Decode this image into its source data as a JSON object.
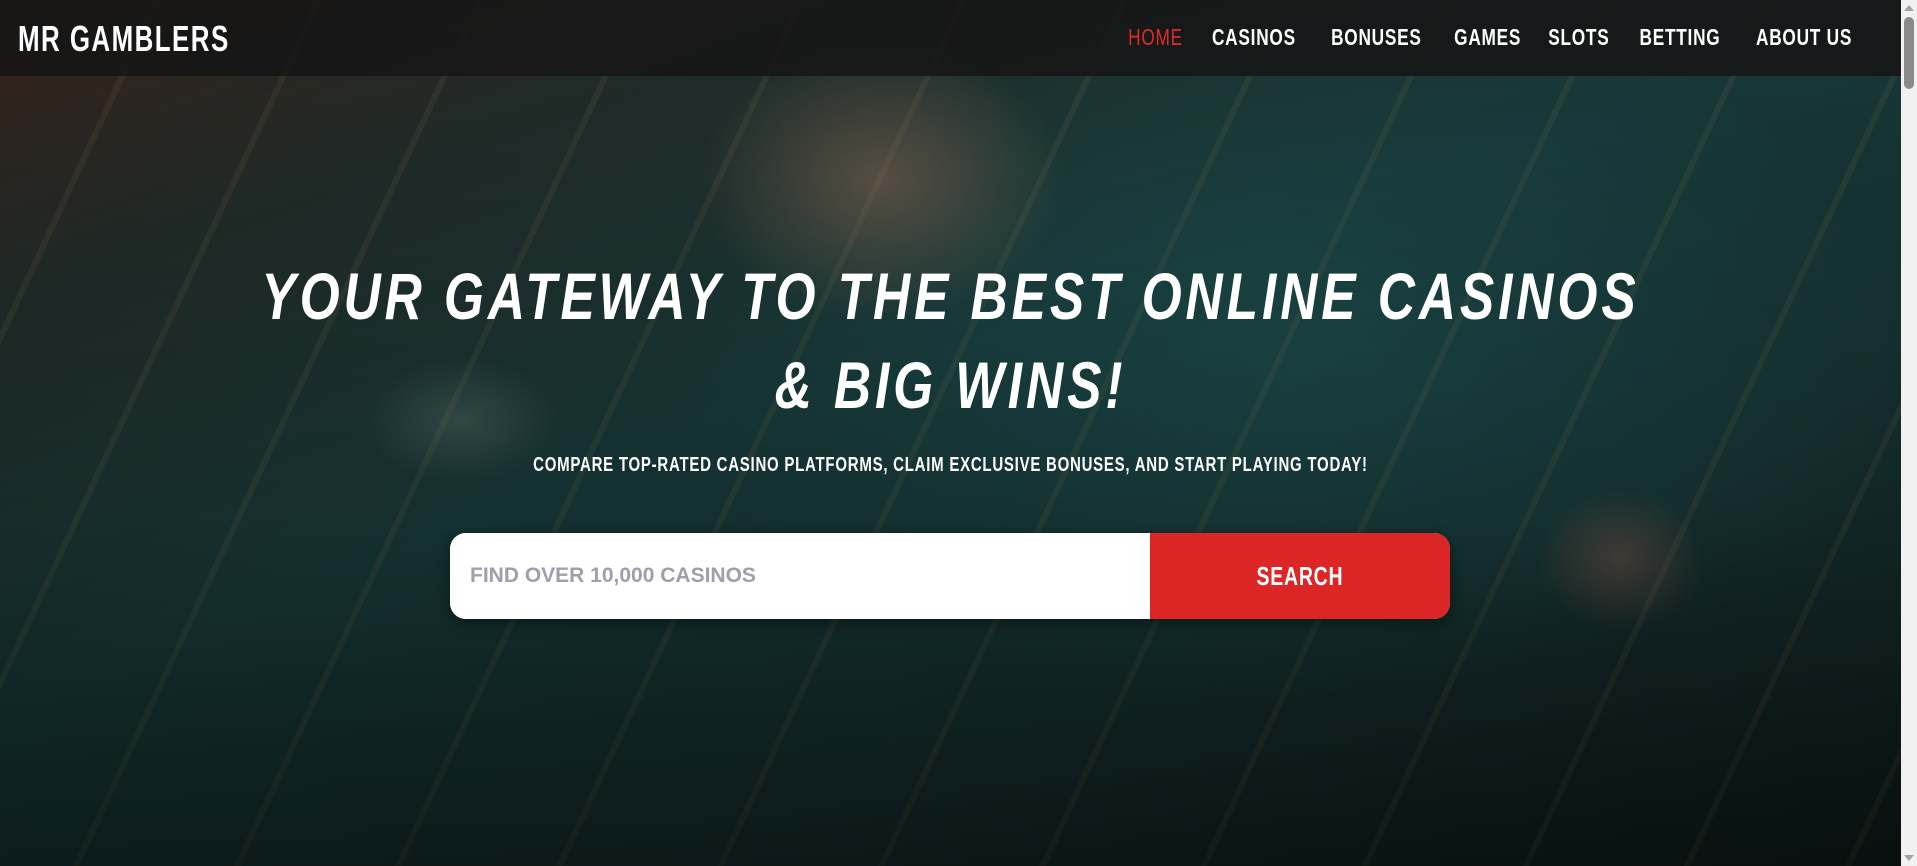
{
  "brand": {
    "name": "MR GAMBLERS"
  },
  "nav": {
    "items": [
      {
        "label": "HOME",
        "active": true
      },
      {
        "label": "CASINOS"
      },
      {
        "label": "BONUSES"
      },
      {
        "label": "GAMES"
      },
      {
        "label": "SLOTS"
      },
      {
        "label": "BETTING"
      },
      {
        "label": "ABOUT US"
      }
    ]
  },
  "hero": {
    "title_line1": "YOUR GATEWAY TO THE BEST ONLINE CASINOS",
    "title_line2": "& BIG WINS!",
    "subtitle": "COMPARE TOP-RATED CASINO PLATFORMS, CLAIM EXCLUSIVE BONUSES, AND START PLAYING TODAY!"
  },
  "search": {
    "placeholder": "FIND OVER 10,000 CASINOS",
    "value": "",
    "button_label": "SEARCH"
  },
  "colors": {
    "accent": "#dc2626",
    "nav_bg": "#161616"
  }
}
